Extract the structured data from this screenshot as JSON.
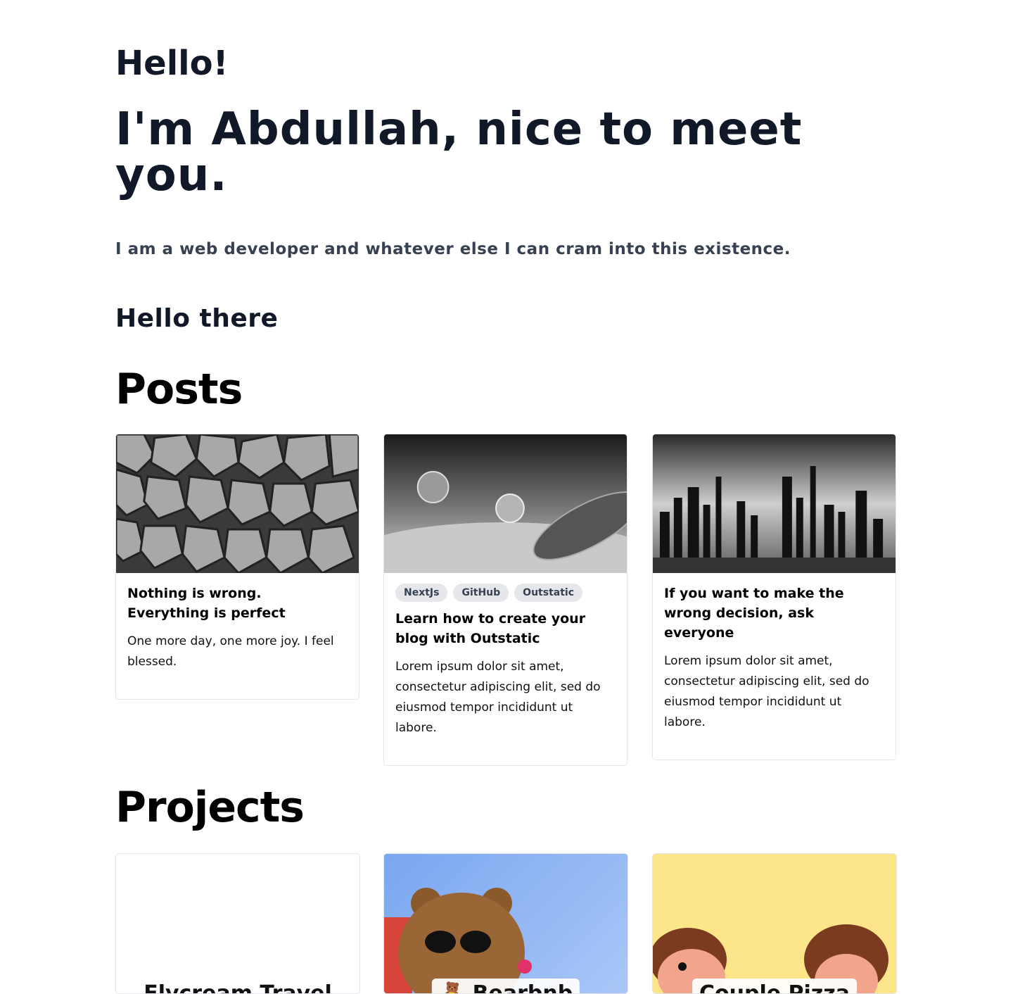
{
  "intro": {
    "greeting": "Hello!",
    "headline": "I'm Abdullah, nice to meet you.",
    "tagline": "I am a web developer and whatever else I can cram into this existence.",
    "subheading": "Hello there"
  },
  "posts": {
    "title": "Posts",
    "items": [
      {
        "title": "Nothing is wrong. Everything is perfect",
        "excerpt": "One more day, one more joy. I feel blessed.",
        "tags": []
      },
      {
        "title": "Learn how to create your blog with Outstatic",
        "excerpt": "Lorem ipsum dolor sit amet, consectetur adipiscing elit, sed do eiusmod tempor incididunt ut labore.",
        "tags": [
          "NextJs",
          "GitHub",
          "Outstatic"
        ]
      },
      {
        "title": "If you want to make the wrong decision, ask everyone",
        "excerpt": "Lorem ipsum dolor sit amet, consectetur adipiscing elit, sed do eiusmod tempor incididunt ut labore.",
        "tags": []
      }
    ]
  },
  "projects": {
    "title": "Projects",
    "items": [
      {
        "label": "Flycream Travel"
      },
      {
        "label": "Bearbnb"
      },
      {
        "label": "Couple Pizza"
      }
    ]
  }
}
